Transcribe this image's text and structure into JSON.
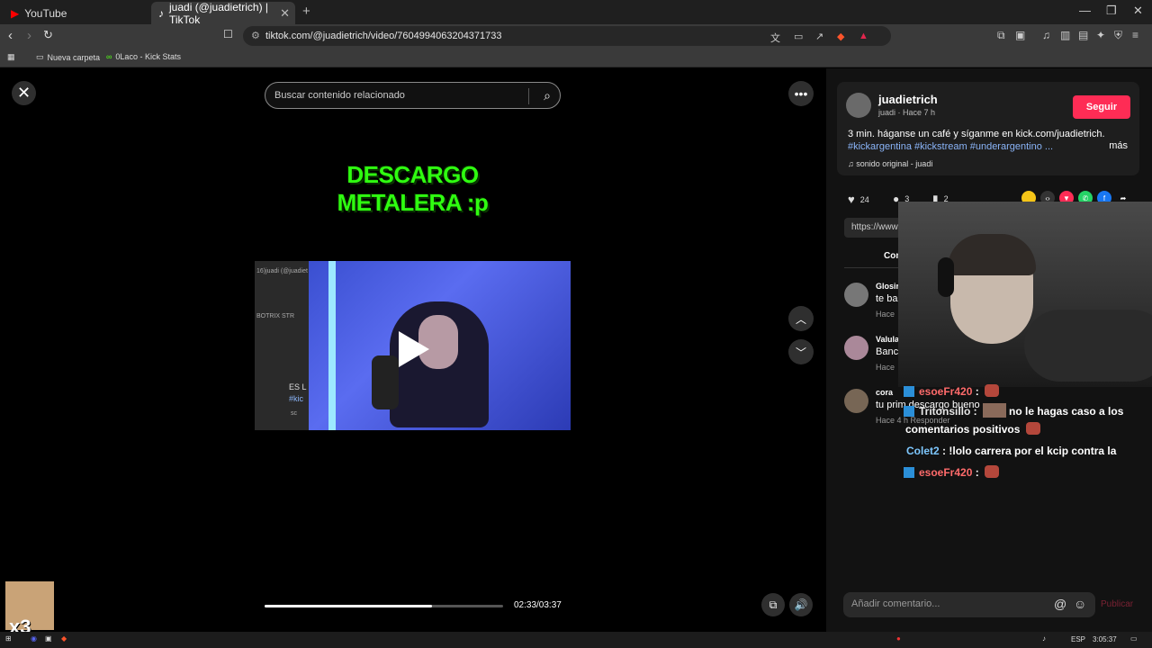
{
  "browser": {
    "tabs": [
      {
        "label": "YouTube"
      },
      {
        "label": "juadi (@juadietrich) | TikTok"
      }
    ],
    "url": "tiktok.com/@juadietrich/video/7604994063204371733",
    "bookmarks": [
      "Nueva carpeta",
      "0Laco - Kick Stats"
    ]
  },
  "video": {
    "search_placeholder": "Buscar contenido relacionado",
    "overlay_text_line1": "DESCARGO",
    "overlay_text_line2": "METALERA :p",
    "progress": 0.7,
    "time": "02:33/03:37",
    "frame_left_labels": [
      "16)juadi (@juadiet",
      "BOTRIX",
      "STR",
      "ES L",
      "#kic",
      "sc"
    ]
  },
  "panel": {
    "username": "juadietrich",
    "sub": "juadi · Hace 7 h",
    "follow_label": "Seguir",
    "description": "3 min. háganse un café y síganme en kick.com/juadietrich.",
    "tags": "#kickargentina #kickstream #underargentino ...",
    "more_label": "más",
    "sound": "sonido original - juadi",
    "likes": "24",
    "comments_count": "3",
    "saves": "2",
    "link_text": "https://www",
    "comments_tab": "Com",
    "comments": [
      {
        "name": "Glosir",
        "text": "te ba",
        "meta": "Hace"
      },
      {
        "name": "Valula",
        "text": "Banc",
        "meta": "Hace"
      },
      {
        "name": "cora",
        "text": "tu prim descargo bueno",
        "meta": "Hace 4 h   Responder"
      }
    ],
    "comment_placeholder": "Añadir comentario...",
    "publish_label": "Publicar"
  },
  "chat": [
    {
      "user": "esoeFr420",
      "text": ""
    },
    {
      "user": "Tritonsillo",
      "text": "no le hagas caso a los"
    },
    {
      "user": "",
      "text": "comentarios positivos"
    },
    {
      "user": "Colet2",
      "text": "!lolo carrera por el kcip contra la"
    },
    {
      "user": "esoeFr420",
      "text": ""
    }
  ],
  "taskbar": {
    "lang": "ESP",
    "time": "3:05:37"
  },
  "pet_label": "x3",
  "colors": {
    "accent": "#fe2c55",
    "overlay_text": "#2fff10",
    "chat_user": "#ff6b6b",
    "chat_user2": "#7ec8ff"
  }
}
